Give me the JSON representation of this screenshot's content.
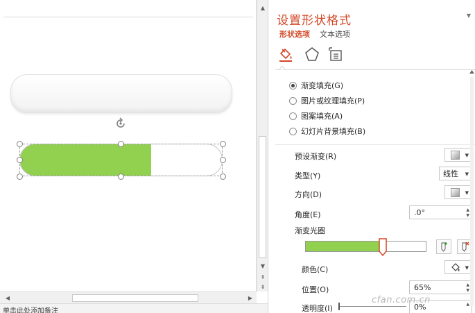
{
  "pane": {
    "title": "设置形状格式",
    "tabs": {
      "shape": "形状选项",
      "text": "文本选项"
    },
    "icons": [
      "fill-line-icon",
      "effects-icon",
      "size-properties-icon"
    ],
    "fill_options": [
      {
        "label": "渐变填充(G)",
        "selected": true
      },
      {
        "label": "图片或纹理填充(P)",
        "selected": false
      },
      {
        "label": "图案填充(A)",
        "selected": false
      },
      {
        "label": "幻灯片背景填充(B)",
        "selected": false
      }
    ],
    "preset_gradient": {
      "label": "预设渐变(R)"
    },
    "type": {
      "label": "类型(Y)",
      "value": "线性"
    },
    "direction": {
      "label": "方向(D)"
    },
    "angle": {
      "label": "角度(E)",
      "value": ".0°"
    },
    "gradient_stops": {
      "label": "渐变光圈",
      "stop_position": 0.65
    },
    "color": {
      "label": "颜色(C)"
    },
    "position": {
      "label": "位置(O)",
      "value": "65%"
    },
    "transparency": {
      "label": "透明度(I)",
      "value": "0%"
    }
  },
  "canvas": {
    "progress_fill": 0.65,
    "status_text": "单击此处添加备注"
  },
  "colors": {
    "accent": "#d24726",
    "fill": "#92d050"
  },
  "watermark": "cfan.com.cn"
}
